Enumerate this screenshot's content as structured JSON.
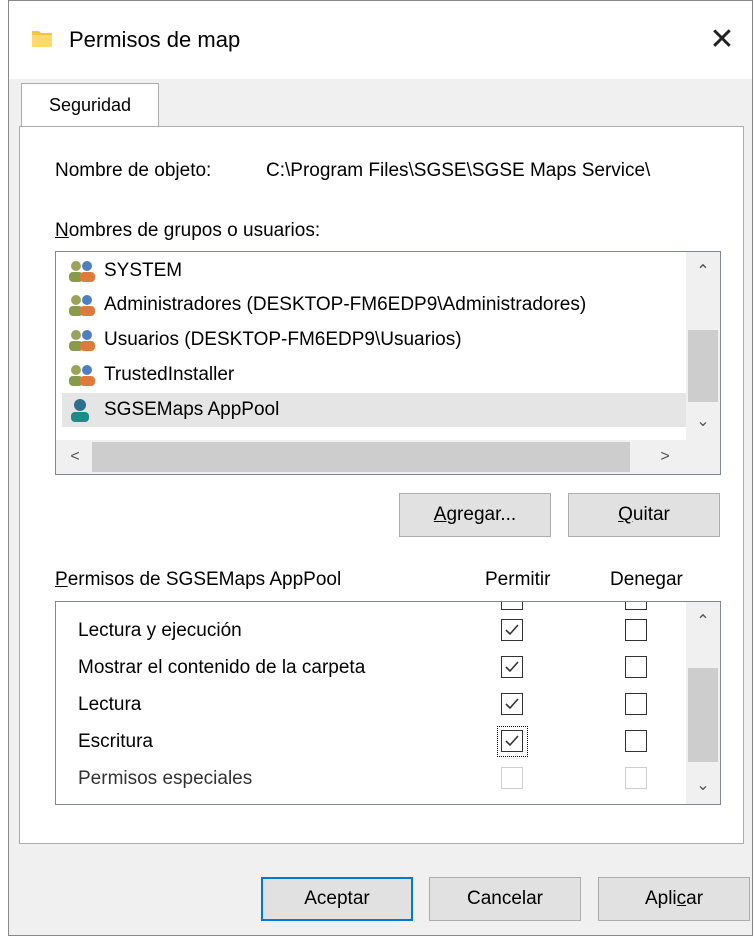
{
  "window": {
    "title": "Permisos de map",
    "close_glyph": "✕"
  },
  "tabs": [
    {
      "label": "Seguridad",
      "selected": true
    }
  ],
  "object": {
    "label": "Nombre de objeto:",
    "value": "C:\\Program Files\\SGSE\\SGSE Maps Service\\"
  },
  "groups": {
    "label_mnemonic": "N",
    "label_rest": "ombres de grupos o usuarios:",
    "items": [
      {
        "name": "SYSTEM",
        "icon": "users-group-icon"
      },
      {
        "name": "Administradores (DESKTOP-FM6EDP9\\Administradores)",
        "icon": "users-group-icon"
      },
      {
        "name": "Usuarios (DESKTOP-FM6EDP9\\Usuarios)",
        "icon": "users-group-icon"
      },
      {
        "name": "TrustedInstaller",
        "icon": "users-group-icon"
      },
      {
        "name": "SGSEMaps AppPool",
        "icon": "single-user-icon",
        "selected": true
      }
    ]
  },
  "buttons": {
    "add_mnemonic": "A",
    "add_rest": "gregar...",
    "remove_mnemonic": "Q",
    "remove_rest": "uitar",
    "ok": "Aceptar",
    "cancel": "Cancelar",
    "apply_pre": "Apli",
    "apply_mnemonic": "c",
    "apply_post": "ar"
  },
  "permissions": {
    "header_mnemonic": "P",
    "header_rest": "ermisos de SGSEMaps AppPool",
    "allow_header": "Permitir",
    "deny_header": "Denegar",
    "rows": [
      {
        "name": "Lectura y ejecución",
        "allow": true,
        "deny": false,
        "enabled": true
      },
      {
        "name": "Mostrar el contenido de la carpeta",
        "allow": true,
        "deny": false,
        "enabled": true
      },
      {
        "name": "Lectura",
        "allow": true,
        "deny": false,
        "enabled": true
      },
      {
        "name": "Escritura",
        "allow": true,
        "deny": false,
        "enabled": true,
        "focused": true
      },
      {
        "name": "Permisos especiales",
        "allow": false,
        "deny": false,
        "enabled": false
      }
    ]
  },
  "colors": {
    "dialog_bg": "#f0f0f0",
    "accent": "#0078d7",
    "selection": "#e5e5e5"
  }
}
